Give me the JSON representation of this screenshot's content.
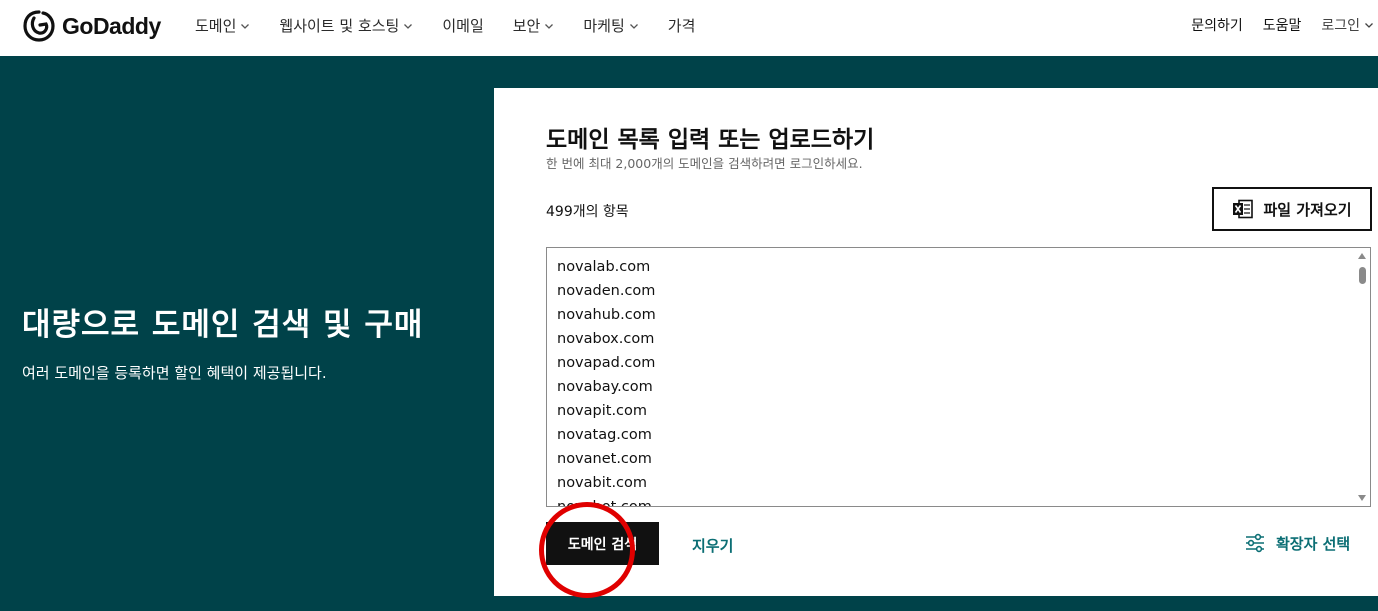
{
  "logo": {
    "text": "GoDaddy"
  },
  "nav": {
    "items": [
      {
        "label": "도메인",
        "has_dropdown": true
      },
      {
        "label": "웹사이트 및 호스팅",
        "has_dropdown": true
      },
      {
        "label": "이메일",
        "has_dropdown": false
      },
      {
        "label": "보안",
        "has_dropdown": true
      },
      {
        "label": "마케팅",
        "has_dropdown": true
      },
      {
        "label": "가격",
        "has_dropdown": false
      }
    ],
    "right": {
      "contact": "문의하기",
      "help": "도움말",
      "login": "로그인"
    }
  },
  "hero": {
    "title": "대량으로 도메인 검색 및 구매",
    "subtitle": "여러 도메인을 등록하면 할인 혜택이 제공됩니다."
  },
  "card": {
    "title": "도메인 목록 입력 또는 업로드하기",
    "subtitle": "한 번에 최대 2,000개의 도메인을 검색하려면 로그인하세요.",
    "count_label": "499개의 항목",
    "import_button": "파일 가져오기",
    "domains": [
      "novalab.com",
      "novaden.com",
      "novahub.com",
      "novabox.com",
      "novapad.com",
      "novabay.com",
      "novapit.com",
      "novatag.com",
      "novanet.com",
      "novabit.com",
      "novabot.com"
    ],
    "search_button": "도메인 검색",
    "clear_link": "지우기",
    "extension_select": "확장자 선택"
  },
  "colors": {
    "hero_bg": "#004249",
    "accent_teal": "#0b6e74",
    "annotation_red": "#e00000"
  }
}
